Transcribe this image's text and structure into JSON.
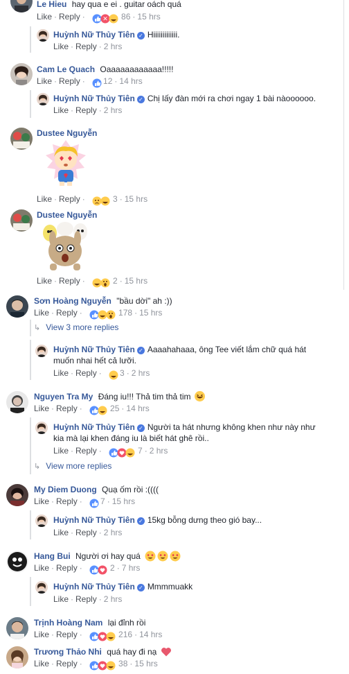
{
  "actions": {
    "like": "Like",
    "reply": "Reply",
    "separator": "·"
  },
  "comments": [
    {
      "name": "Le Hieu",
      "text": "hay qua e ei . guitar oách quá",
      "reactions": [
        "like",
        "wow",
        "haha"
      ],
      "count": "86",
      "time": "15 hrs"
    },
    {
      "name": "Huỳnh Nữ Thủy Tiên",
      "verified": true,
      "text": "Hiiiiiiiiiiiii.",
      "time": "2 hrs"
    },
    {
      "name": "Cam Le Quach",
      "text": "Oaaaaaaaaaaaa!!!!!",
      "reactions": [
        "like"
      ],
      "count": "12",
      "time": "14 hrs"
    },
    {
      "name": "Huỳnh Nữ Thủy Tiên",
      "verified": true,
      "text": "Chị lấy đàn mới ra chơi ngay 1 bài nàoooooo.",
      "time": "2 hrs"
    },
    {
      "name": "Dustee Nguyễn",
      "sticker": "blonde-kid-hearts-sticker",
      "reactions": [
        "sad",
        "haha"
      ],
      "count": "3",
      "time": "15 hrs"
    },
    {
      "name": "Dustee Nguyễn",
      "sticker": "bunny-crowd-sticker",
      "reactions": [
        "haha",
        "wow"
      ],
      "count": "2",
      "time": "15 hrs"
    },
    {
      "name": "Sơn Hoàng Nguyễn",
      "text": "\"bầu dời\" ah :))",
      "reactions": [
        "like",
        "haha",
        "wow"
      ],
      "count": "178",
      "time": "15 hrs",
      "more_replies": "View 3 more replies"
    },
    {
      "name": "Huỳnh Nữ Thủy Tiên",
      "verified": true,
      "text": "Aaaahahaaa, ông Tee viết lắm chữ quá hát",
      "text2": "muốn nhai hết cả lưỡi.",
      "reactions": [
        "haha"
      ],
      "count": "3",
      "time": "2 hrs"
    },
    {
      "name": "Nguyen Tra My",
      "text": "Đáng iu!!! Thả tim thả tim",
      "reactions": [
        "like",
        "haha"
      ],
      "count": "25",
      "time": "14 hrs"
    },
    {
      "name": "Huỳnh Nữ Thủy Tiên",
      "verified": true,
      "text": "Người ta hát nhưng không khen như này như",
      "text2": "kia mà lại khen đáng iu là biết hát ghê rồi..",
      "reactions": [
        "like",
        "love",
        "haha"
      ],
      "count": "7",
      "time": "2 hrs",
      "more_replies": "View more replies"
    },
    {
      "name": "My Diem Duong",
      "text": "Quạ ốm rồi :((((",
      "reactions": [
        "like"
      ],
      "count": "7",
      "time": "15 hrs"
    },
    {
      "name": "Huỳnh Nữ Thủy Tiên",
      "verified": true,
      "text": "15kg bỗng dưng theo gió bay...",
      "time": "2 hrs"
    },
    {
      "name": "Hang Bui",
      "text": "Người ơi hay quá",
      "reactions": [
        "like",
        "love"
      ],
      "count": "2",
      "time": "7 hrs"
    },
    {
      "name": "Huỳnh Nữ Thủy Tiên",
      "verified": true,
      "text": "Mmmmuakk",
      "time": "2 hrs"
    },
    {
      "name": "Trịnh Hoàng Nam",
      "text": "lại đỉnh rồi",
      "reactions": [
        "like",
        "love",
        "haha"
      ],
      "count": "216",
      "time": "14 hrs"
    },
    {
      "name": "Trương Thảo Nhi",
      "text": "quá hay đi nạ",
      "reactions": [
        "like",
        "love",
        "haha"
      ],
      "count": "38",
      "time": "15 hrs"
    }
  ],
  "colors": {
    "name": "#365899",
    "like": "#5890ff",
    "love": "#f25268",
    "haha": "#ffcc4d",
    "meta": "#90949c",
    "verified": "#4a79e0"
  }
}
